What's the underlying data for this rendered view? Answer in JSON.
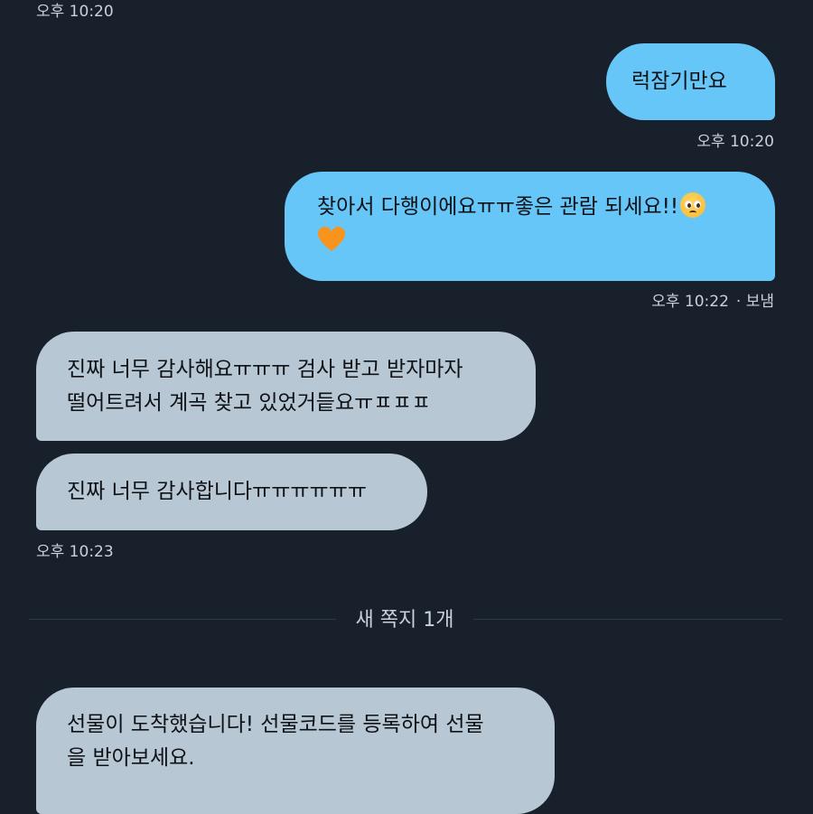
{
  "messages": [
    {
      "id": "m0_time",
      "time": "오후 10:20"
    },
    {
      "id": "m1",
      "text": "럭잠기만요",
      "time": "오후 10:20"
    },
    {
      "id": "m2",
      "text": "찾아서 다행이에요ㅠㅠ좋은 관람 되세요!!",
      "time": "오후 10:22",
      "status": "· 보냄",
      "emojis": [
        "pleading-face-icon",
        "orange-heart-icon"
      ]
    },
    {
      "id": "m3",
      "text": "진짜 너무 감사해요ㅠㅠㅠ 검사 받고 받자마자\n떨어트려서 계곡 찾고 있었거듵요ㅠㅍㅍㅍ"
    },
    {
      "id": "m4",
      "text": "진짜 너무 감사합니다ㅠㅠㅠㅠㅠㅠ",
      "time": "오후 10:23"
    },
    {
      "id": "m5",
      "text": "선물이 도착했습니다! 선물코드를 등록하여 선물\n을 받아보세요."
    }
  ],
  "divider": {
    "label": "새 쪽지 1개"
  },
  "colors": {
    "background": "#17202b",
    "outgoing_bubble": "#67c6f8",
    "incoming_bubble": "#b8c7d4",
    "timestamp": "#c9d2dc"
  }
}
